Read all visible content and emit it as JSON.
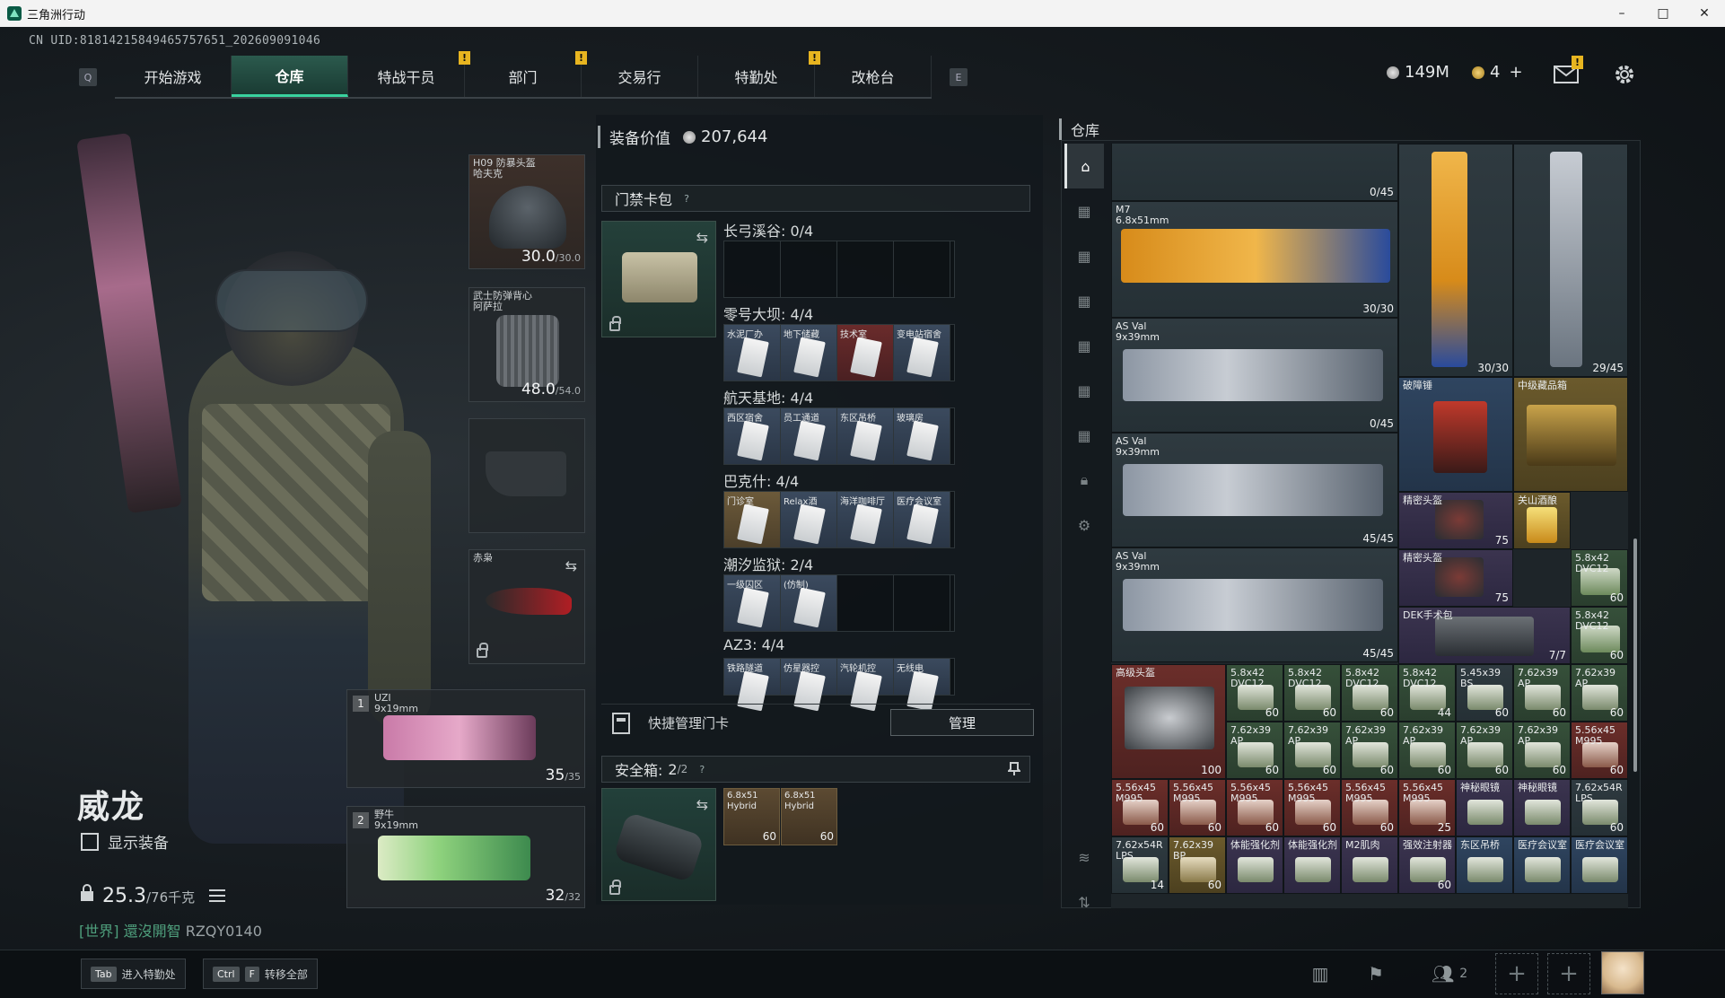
{
  "window": {
    "title": "三角洲行动",
    "minimize": "–",
    "maximize": "□",
    "close": "✕"
  },
  "uid": "CN UID:81814215849465757651_202609091046",
  "nav": {
    "key_left": "Q",
    "key_right": "E",
    "tabs": [
      {
        "label": "开始游戏",
        "active": false,
        "alert": false
      },
      {
        "label": "仓库",
        "active": true,
        "alert": false
      },
      {
        "label": "特战干员",
        "active": false,
        "alert": true
      },
      {
        "label": "部门",
        "active": false,
        "alert": true
      },
      {
        "label": "交易行",
        "active": false,
        "alert": false
      },
      {
        "label": "特勤处",
        "active": false,
        "alert": true
      },
      {
        "label": "改枪台",
        "active": false,
        "alert": false
      }
    ],
    "alert_glyph": "!"
  },
  "currency": {
    "coins": "149M",
    "tickets": "4",
    "add": "+"
  },
  "character": {
    "name": "威龙",
    "show_equipment": "显示装备",
    "weight": "25.3",
    "weight_max": "/76千克",
    "chat_channel": "[世界]",
    "chat_text": "還沒開智",
    "chat_id": "RZQY0140"
  },
  "equipment": {
    "helmet": {
      "label": "H09 防暴头盔\n哈夫克",
      "durability": "30.0",
      "max": "/30.0"
    },
    "armor": {
      "label": "武士防弹背心\n阿萨拉",
      "durability": "48.0",
      "max": "/54.0"
    },
    "melee": {
      "label": "赤枭"
    },
    "primary": {
      "slot": "1",
      "label": "UZI\n9x19mm",
      "ammo": "35",
      "max": "/35"
    },
    "secondary": {
      "slot": "2",
      "label": "野牛\n9x19mm",
      "ammo": "32",
      "max": "/32"
    }
  },
  "middle": {
    "title": "装备价值",
    "value": "207,644",
    "keycard_wallet": "门禁卡包",
    "help": "?",
    "groups": [
      {
        "title": "长弓溪谷: 0/4",
        "cards": []
      },
      {
        "title": "零号大坝: 4/4",
        "cards": [
          {
            "label": "水泥厂办",
            "color": "blue"
          },
          {
            "label": "地下储藏",
            "color": "blue"
          },
          {
            "label": "技术室",
            "color": "red"
          },
          {
            "label": "变电站宿舍",
            "color": "blue"
          }
        ]
      },
      {
        "title": "航天基地: 4/4",
        "cards": [
          {
            "label": "西区宿舍",
            "color": "blue"
          },
          {
            "label": "员工通道",
            "color": "blue"
          },
          {
            "label": "东区吊桥",
            "color": "blue"
          },
          {
            "label": "玻璃房",
            "color": "blue"
          }
        ]
      },
      {
        "title": "巴克什: 4/4",
        "cards": [
          {
            "label": "门诊室",
            "color": "tan"
          },
          {
            "label": "Relax酒",
            "color": "blue"
          },
          {
            "label": "海洋咖啡厅",
            "color": "blue"
          },
          {
            "label": "医疗会议室",
            "color": "blue"
          }
        ]
      },
      {
        "title": "潮汐监狱: 2/4",
        "cards": [
          {
            "label": "一级囚区",
            "color": "blue"
          },
          {
            "label": "(仿制)",
            "color": "blue"
          }
        ]
      },
      {
        "title": "AZ3: 4/4",
        "cards": [
          {
            "label": "铁路隧道",
            "color": "blue"
          },
          {
            "label": "仿星器控",
            "color": "blue"
          },
          {
            "label": "汽轮机控",
            "color": "blue"
          },
          {
            "label": "无线电",
            "color": "blue"
          }
        ]
      }
    ],
    "quick_manage": "快捷管理门卡",
    "manage_btn": "管理",
    "safebox_label": "安全箱:",
    "safebox_count": "2",
    "safebox_max": "/2",
    "safebox_items": [
      {
        "label": "6.8x51\nHybrid",
        "count": "60"
      },
      {
        "label": "6.8x51\nHybrid",
        "count": "60"
      }
    ]
  },
  "storage": {
    "title": "仓库",
    "items": [
      {
        "name": "",
        "qty": "0/45",
        "color": "grey"
      },
      {
        "name": "M7\n6.8x51mm",
        "qty": "30/30",
        "color": "grey"
      },
      {
        "name": "",
        "qty": "30/30",
        "color": "grey"
      },
      {
        "name": "",
        "qty": "29/45",
        "color": "grey"
      },
      {
        "name": "AS Val\n9x39mm",
        "qty": "0/45",
        "color": "grey"
      },
      {
        "name": "破障锤",
        "qty": "",
        "color": "blue"
      },
      {
        "name": "中级藏品箱",
        "qty": "",
        "color": "gold"
      },
      {
        "name": "AS Val\n9x39mm",
        "qty": "45/45",
        "color": "grey"
      },
      {
        "name": "精密头盔",
        "qty": "75",
        "color": "purple"
      },
      {
        "name": "关山酒酿",
        "qty": "",
        "color": "gold"
      },
      {
        "name": "AS Val\n9x39mm",
        "qty": "45/45",
        "color": "grey"
      },
      {
        "name": "精密头盔",
        "qty": "75",
        "color": "purple"
      },
      {
        "name": "5.8x42\nDVC12",
        "qty": "60",
        "color": "green"
      },
      {
        "name": "DEK手术包",
        "qty": "7/7",
        "color": "purple"
      },
      {
        "name": "5.8x42\nDVC12",
        "qty": "60",
        "color": "green"
      },
      {
        "name": "高级头盔",
        "qty": "100",
        "color": "red"
      }
    ],
    "ammo_row1": [
      {
        "name": "5.8x42\nDVC12",
        "qty": "60",
        "color": "green"
      },
      {
        "name": "5.8x42\nDVC12",
        "qty": "60",
        "color": "green"
      },
      {
        "name": "5.8x42\nDVC12",
        "qty": "60",
        "color": "green"
      },
      {
        "name": "5.8x42\nDVC12",
        "qty": "44",
        "color": "green"
      },
      {
        "name": "5.45x39\nBS",
        "qty": "60",
        "color": "grey"
      },
      {
        "name": "7.62x39\nAP",
        "qty": "60",
        "color": "green"
      },
      {
        "name": "7.62x39\nAP",
        "qty": "60",
        "color": "green"
      }
    ],
    "ammo_row2": [
      {
        "name": "7.62x39\nAP",
        "qty": "60",
        "color": "green"
      },
      {
        "name": "7.62x39\nAP",
        "qty": "60",
        "color": "green"
      },
      {
        "name": "7.62x39\nAP",
        "qty": "60",
        "color": "green"
      },
      {
        "name": "7.62x39\nAP",
        "qty": "60",
        "color": "green"
      },
      {
        "name": "7.62x39\nAP",
        "qty": "60",
        "color": "green"
      },
      {
        "name": "7.62x39\nAP",
        "qty": "60",
        "color": "green"
      },
      {
        "name": "5.56x45\nM995",
        "qty": "60",
        "color": "red"
      }
    ],
    "row3": [
      {
        "name": "5.56x45\nM995",
        "qty": "60",
        "color": "red"
      },
      {
        "name": "5.56x45\nM995",
        "qty": "60",
        "color": "red"
      },
      {
        "name": "5.56x45\nM995",
        "qty": "60",
        "color": "red"
      },
      {
        "name": "5.56x45\nM995",
        "qty": "60",
        "color": "red"
      },
      {
        "name": "5.56x45\nM995",
        "qty": "60",
        "color": "red"
      },
      {
        "name": "5.56x45\nM995",
        "qty": "25",
        "color": "red"
      },
      {
        "name": "神秘眼镜",
        "qty": "",
        "color": "purple"
      },
      {
        "name": "神秘眼镜",
        "qty": "",
        "color": "purple"
      },
      {
        "name": "7.62x54R\nLPS",
        "qty": "60",
        "color": "grey"
      }
    ],
    "row4": [
      {
        "name": "7.62x54R\nLPS",
        "qty": "14",
        "color": "grey"
      },
      {
        "name": "7.62x39\nBP",
        "qty": "60",
        "color": "gold"
      },
      {
        "name": "体能强化剂",
        "qty": "",
        "color": "purple"
      },
      {
        "name": "体能强化剂",
        "qty": "",
        "color": "purple"
      },
      {
        "name": "M2肌肉",
        "qty": "",
        "color": "purple"
      },
      {
        "name": "强效注射器",
        "qty": "60",
        "color": "purple"
      },
      {
        "name": "东区吊桥",
        "qty": "",
        "color": "blue"
      },
      {
        "name": "医疗会议室",
        "qty": "",
        "color": "blue"
      },
      {
        "name": "医疗会议室",
        "qty": "",
        "color": "blue"
      }
    ]
  },
  "bottom": {
    "hint1_key": "Tab",
    "hint1": "进入特勤处",
    "hint2_key1": "Ctrl",
    "hint2_key2": "F",
    "hint2": "转移全部",
    "squad_count": "2"
  },
  "colors": {
    "accent": "#39d29f",
    "tab_active": "#2b5a4d",
    "alert": "#e8b520"
  }
}
